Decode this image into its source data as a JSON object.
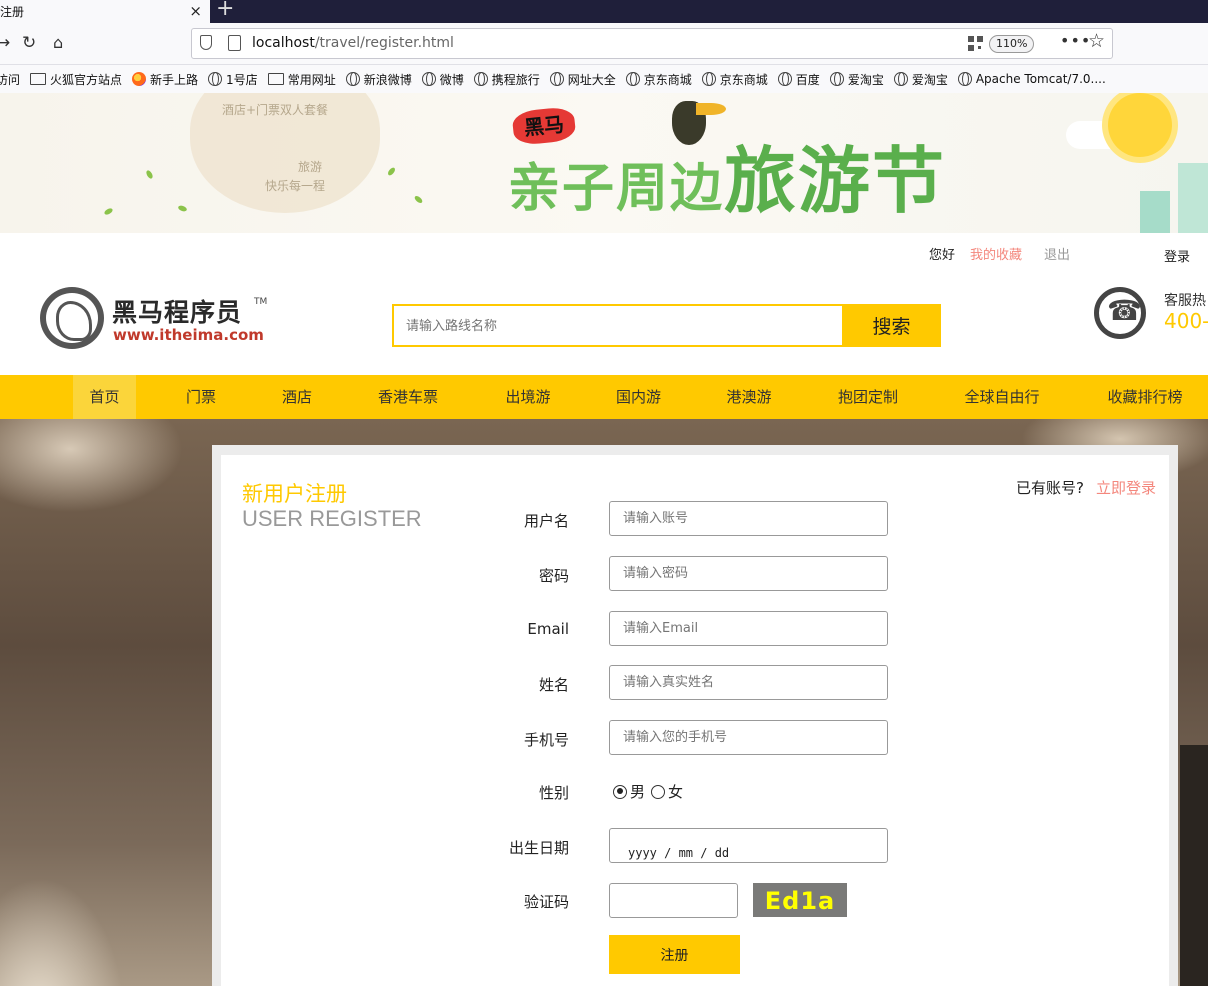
{
  "browser": {
    "tab_title": "注册",
    "tab_close": "×",
    "new_tab": "+",
    "url_host": "localhost",
    "url_path": "/travel/register.html",
    "zoom": "110%",
    "bookmarks": [
      {
        "label": "访问",
        "icon": "none"
      },
      {
        "label": "火狐官方站点",
        "icon": "folder"
      },
      {
        "label": "新手上路",
        "icon": "firefox"
      },
      {
        "label": "1号店",
        "icon": "globe"
      },
      {
        "label": "常用网址",
        "icon": "folder"
      },
      {
        "label": "新浪微博",
        "icon": "globe"
      },
      {
        "label": "微博",
        "icon": "globe"
      },
      {
        "label": "携程旅行",
        "icon": "globe"
      },
      {
        "label": "网址大全",
        "icon": "globe"
      },
      {
        "label": "京东商城",
        "icon": "globe"
      },
      {
        "label": "京东商城",
        "icon": "globe"
      },
      {
        "label": "百度",
        "icon": "globe"
      },
      {
        "label": "爱淘宝",
        "icon": "globe"
      },
      {
        "label": "爱淘宝",
        "icon": "globe"
      },
      {
        "label": "Apache Tomcat/7.0....",
        "icon": "globe"
      }
    ]
  },
  "banner": {
    "line1": "酒店+门票双人套餐",
    "line2": "旅游",
    "line3": "快乐每一程",
    "brand": "黑马",
    "title_a": "亲子周边",
    "title_b": "旅游节"
  },
  "header": {
    "greeting": "您好",
    "favorites": "我的收藏",
    "logout": "退出",
    "login": "登录",
    "logo_cn": "黑马程序员",
    "logo_tm": "TM",
    "logo_en": "www.itheima.com",
    "search_placeholder": "请输入路线名称",
    "search_button": "搜索",
    "hotline_label": "客服热",
    "hotline_number": "400-"
  },
  "nav": [
    "首页",
    "门票",
    "酒店",
    "香港车票",
    "出境游",
    "国内游",
    "港澳游",
    "抱团定制",
    "全球自由行",
    "收藏排行榜"
  ],
  "register": {
    "title": "新用户注册",
    "subtitle": "USER REGISTER",
    "has_account": "已有账号?",
    "login_now": "立即登录",
    "fields": [
      {
        "label": "用户名",
        "placeholder": "请输入账号"
      },
      {
        "label": "密码",
        "placeholder": "请输入密码"
      },
      {
        "label": "Email",
        "placeholder": "请输入Email"
      },
      {
        "label": "姓名",
        "placeholder": "请输入真实姓名"
      },
      {
        "label": "手机号",
        "placeholder": "请输入您的手机号"
      }
    ],
    "gender_label": "性别",
    "gender_male": "男",
    "gender_female": "女",
    "birthday_label": "出生日期",
    "birthday_placeholder": "yyyy / mm / dd",
    "captcha_label": "验证码",
    "captcha_text": "Ed1a",
    "submit": "注册"
  },
  "colors": {
    "accent": "#ffc900",
    "link_red": "#f4877d",
    "nav_bg": "#ffc900"
  }
}
